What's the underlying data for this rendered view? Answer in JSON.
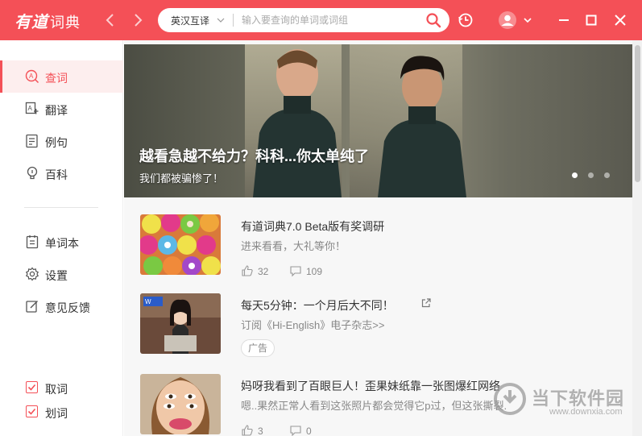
{
  "app": {
    "logo": "有道",
    "logo_suffix": "词典",
    "brand_color": "#f45057"
  },
  "toolbar": {
    "back_icon": "chevron-left-icon",
    "forward_icon": "chevron-right-icon",
    "search": {
      "language": "英汉互译",
      "placeholder": "输入要查询的单词或词组",
      "value": ""
    }
  },
  "sidebar": {
    "items": [
      {
        "label": "查词",
        "icon": "search-word-icon",
        "active": true
      },
      {
        "label": "翻译",
        "icon": "translate-icon",
        "active": false
      },
      {
        "label": "例句",
        "icon": "example-sentence-icon",
        "active": false
      },
      {
        "label": "百科",
        "icon": "encyclopedia-icon",
        "active": false
      }
    ],
    "items2": [
      {
        "label": "单词本",
        "icon": "wordbook-icon"
      },
      {
        "label": "设置",
        "icon": "gear-icon"
      },
      {
        "label": "意见反馈",
        "icon": "feedback-icon"
      }
    ],
    "checks": [
      {
        "label": "取词",
        "checked": true
      },
      {
        "label": "划词",
        "checked": true
      }
    ]
  },
  "banner": {
    "title": "越看急越不给力？科科...你太单纯了",
    "subtitle": "我们都被骗惨了！",
    "dots": 3,
    "active_dot": 0
  },
  "feed": [
    {
      "title": "有道词典7.0 Beta版有奖调研",
      "subtitle": "进来看看，大礼等你！",
      "likes": "32",
      "comments": "109"
    },
    {
      "title": "每天5分钟：一个月后大不同！",
      "subtitle": "订阅《Hi-English》电子杂志>>",
      "ad_label": "广告"
    },
    {
      "title": "妈呀我看到了百眼巨人！歪果妹纸靠一张图爆红网络",
      "subtitle": "嗯..果然正常人看到这张照片都会觉得它p过，但这张撕裂..",
      "likes": "3",
      "comments": "0"
    }
  ],
  "watermark": {
    "name": "当下软件园",
    "url": "www.downxia.com"
  }
}
